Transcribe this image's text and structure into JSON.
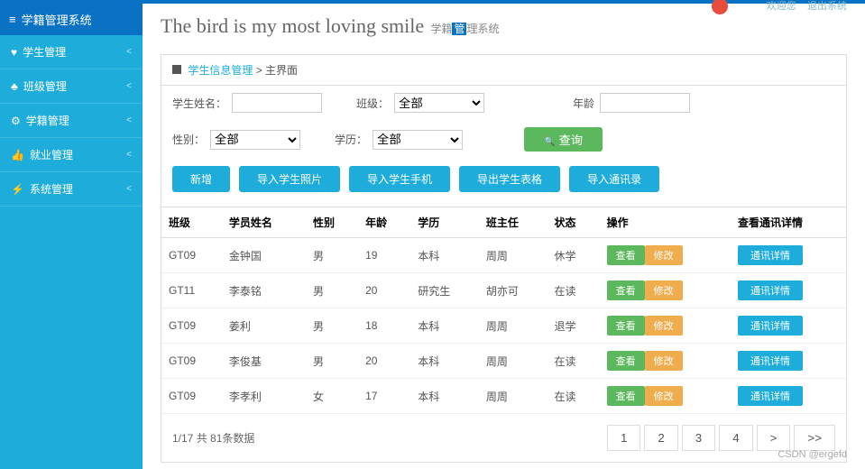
{
  "topbar": {
    "greeting": "欢迎您",
    "logout": "退出系统"
  },
  "sidebar": {
    "title": "学籍管理系统",
    "items": [
      {
        "label": "学生管理",
        "icon": "♥"
      },
      {
        "label": "班级管理",
        "icon": "♣"
      },
      {
        "label": "学籍管理",
        "icon": "⚙"
      },
      {
        "label": "就业管理",
        "icon": "👍"
      },
      {
        "label": "系统管理",
        "icon": "⚡"
      }
    ]
  },
  "header": {
    "title": "The bird is my most loving smile",
    "sub_prefix": "学籍",
    "sub_highlight": "管",
    "sub_suffix": "理系统"
  },
  "breadcrumb": {
    "section": "学生信息管理",
    "current": "主界面"
  },
  "filters": {
    "name_label": "学生姓名：",
    "class_label": "班级：",
    "class_value": "全部",
    "age_label": "年龄",
    "gender_label": "性别：",
    "gender_value": "全部",
    "edu_label": "学历：",
    "edu_value": "全部",
    "search": "查询"
  },
  "actions": [
    "新增",
    "导入学生照片",
    "导入学生手机",
    "导出学生表格",
    "导入通讯录"
  ],
  "table": {
    "headers": [
      "班级",
      "学员姓名",
      "性别",
      "年龄",
      "学历",
      "班主任",
      "状态",
      "操作",
      "查看通讯详情"
    ],
    "btn_view": "查看",
    "btn_edit": "修改",
    "btn_detail": "通讯详情",
    "rows": [
      {
        "class": "GT09",
        "name": "金钟国",
        "gender": "男",
        "age": "19",
        "edu": "本科",
        "teacher": "周周",
        "status": "休学"
      },
      {
        "class": "GT11",
        "name": "李泰铭",
        "gender": "男",
        "age": "20",
        "edu": "研究生",
        "teacher": "胡亦可",
        "status": "在读"
      },
      {
        "class": "GT09",
        "name": "姜利",
        "gender": "男",
        "age": "18",
        "edu": "本科",
        "teacher": "周周",
        "status": "退学"
      },
      {
        "class": "GT09",
        "name": "李俊基",
        "gender": "男",
        "age": "20",
        "edu": "本科",
        "teacher": "周周",
        "status": "在读"
      },
      {
        "class": "GT09",
        "name": "李孝利",
        "gender": "女",
        "age": "17",
        "edu": "本科",
        "teacher": "周周",
        "status": "在读"
      }
    ]
  },
  "pager": {
    "info": "1/17 共 81条数据",
    "pages": [
      "1",
      "2",
      "3",
      "4",
      ">",
      ">>"
    ]
  },
  "watermark": "CSDN @ergefd"
}
